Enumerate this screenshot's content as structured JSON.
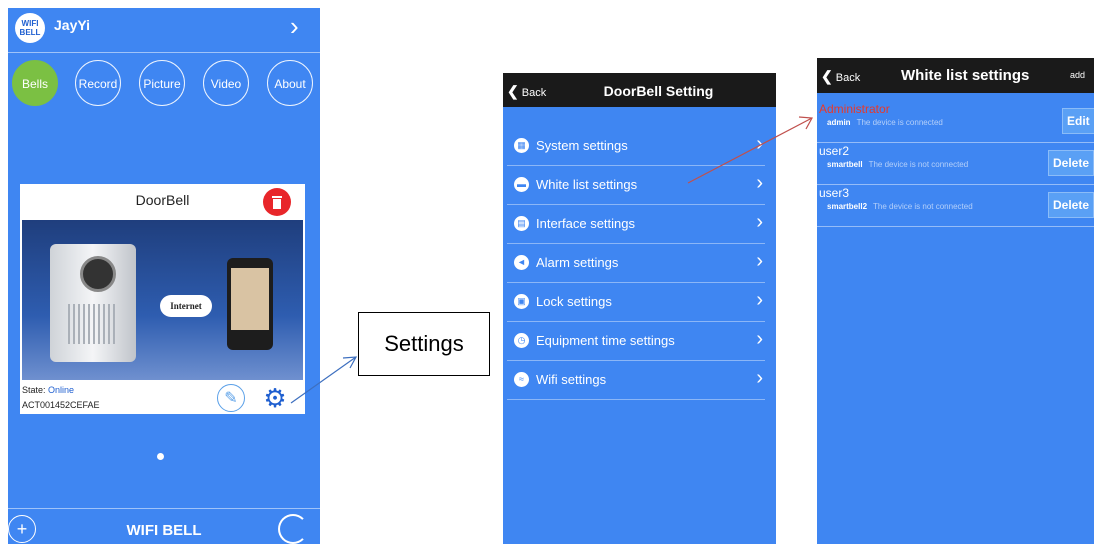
{
  "phone1": {
    "logo": {
      "line1": "WIFI",
      "line2": "BELL"
    },
    "username": "JayYi",
    "tabs": [
      {
        "label": "Bells",
        "selected": true
      },
      {
        "label": "Record",
        "selected": false
      },
      {
        "label": "Picture",
        "selected": false
      },
      {
        "label": "Video",
        "selected": false
      },
      {
        "label": "About",
        "selected": false
      }
    ],
    "card": {
      "title": "DoorBell",
      "cloud_label": "Internet",
      "state_label": "State: ",
      "state_value": "Online",
      "device_id": "ACT001452CEFAE"
    },
    "footer": {
      "plus": "+",
      "brand": "WIFI BELL"
    }
  },
  "callout": {
    "text": "Settings"
  },
  "phone2": {
    "back": "Back",
    "title": "DoorBell  Setting",
    "items": [
      {
        "label": "System settings",
        "icon": "grid-icon"
      },
      {
        "label": "White list settings",
        "icon": "chat-icon"
      },
      {
        "label": "Interface settings",
        "icon": "screen-icon"
      },
      {
        "label": "Alarm settings",
        "icon": "megaphone-icon"
      },
      {
        "label": "Lock settings",
        "icon": "lock-icon"
      },
      {
        "label": "Equipment time settings",
        "icon": "clock-icon"
      },
      {
        "label": "Wifi settings",
        "icon": "wifi-icon"
      }
    ]
  },
  "phone3": {
    "back": "Back",
    "title": "White list settings",
    "add": "add",
    "users": [
      {
        "name": "Administrator",
        "account": "admin",
        "status": "The device is connected",
        "button": "Edit",
        "is_admin": true
      },
      {
        "name": "user2",
        "account": "smartbell",
        "status": "The device is not connected",
        "button": "Delete",
        "is_admin": false
      },
      {
        "name": "user3",
        "account": "smartbell2",
        "status": "The device is not connected",
        "button": "Delete",
        "is_admin": false
      }
    ]
  },
  "colors": {
    "app_blue": "#3f86f2",
    "selected_tab": "#7bc043",
    "admin_red": "#e8392b",
    "header_dark": "#1a1a1a"
  }
}
